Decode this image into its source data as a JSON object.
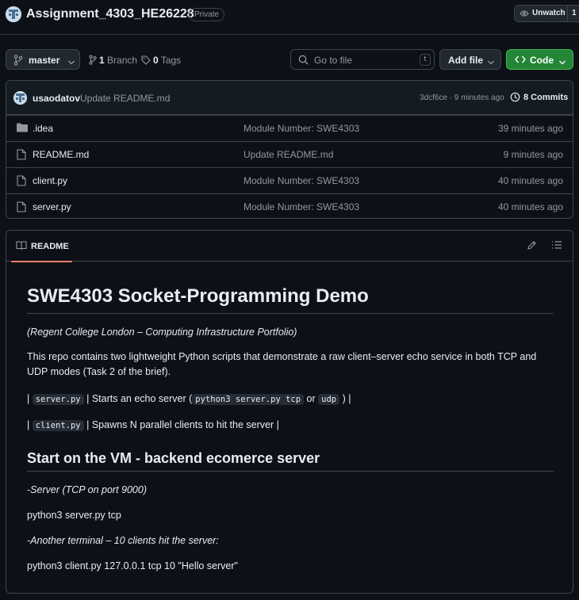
{
  "repo": {
    "name": "Assignment_4303_HE26228",
    "visibility": "Private",
    "watch_label": "Unwatch",
    "watch_count": "1"
  },
  "toolbar": {
    "branch": "master",
    "branch_count": "1",
    "branch_word": "Branch",
    "tag_count": "0",
    "tag_word": "Tags",
    "goto_placeholder": "Go to file",
    "goto_shortcut": "t",
    "add_file": "Add file",
    "code": "Code"
  },
  "latest_commit": {
    "author": "usaodatov",
    "message": "Update README.md",
    "hash_time": "3dcf6ce · 9 minutes ago",
    "commits_label": "8 Commits"
  },
  "files": [
    {
      "name": ".idea",
      "type": "folder",
      "message": "Module Number: SWE4303",
      "age": "39 minutes ago"
    },
    {
      "name": "README.md",
      "type": "file",
      "message": "Update README.md",
      "age": "9 minutes ago"
    },
    {
      "name": "client.py",
      "type": "file",
      "message": "Module Number: SWE4303",
      "age": "40 minutes ago"
    },
    {
      "name": "server.py",
      "type": "file",
      "message": "Module Number: SWE4303",
      "age": "40 minutes ago"
    }
  ],
  "readme": {
    "tab_label": "README",
    "title": "SWE4303 Socket-Programming Demo",
    "subtitle": "(Regent College London – Computing Infrastructure Portfolio)",
    "intro": "This repo contains two lightweight Python scripts that demonstrate a raw client–server echo service in both TCP and UDP modes (Task 2 of the brief).",
    "row1": {
      "pipe1": "|",
      "code1": "server.py",
      "text1": "| Starts an echo server (",
      "code2": "python3 server.py tcp",
      "text2": "or",
      "code3": "udp",
      "text3": ") |"
    },
    "row2": {
      "pipe1": "|",
      "code1": "client.py",
      "text1": "| Spawns N parallel clients to hit the server |"
    },
    "section_title": "Start on the VM - backend ecomerce server",
    "server_note": "-Server (TCP on port 9000)",
    "server_cmd": "python3 server.py tcp",
    "client_note": "-Another terminal – 10 clients hit the server:",
    "client_cmd": "python3 client.py 127.0.0.1 tcp 10 \"Hello server\""
  },
  "colors": {
    "background": "#0d1117",
    "border": "#3d444d",
    "accent_green": "#238636",
    "muted_text": "#9198a1",
    "tab_underline": "#f78166"
  }
}
